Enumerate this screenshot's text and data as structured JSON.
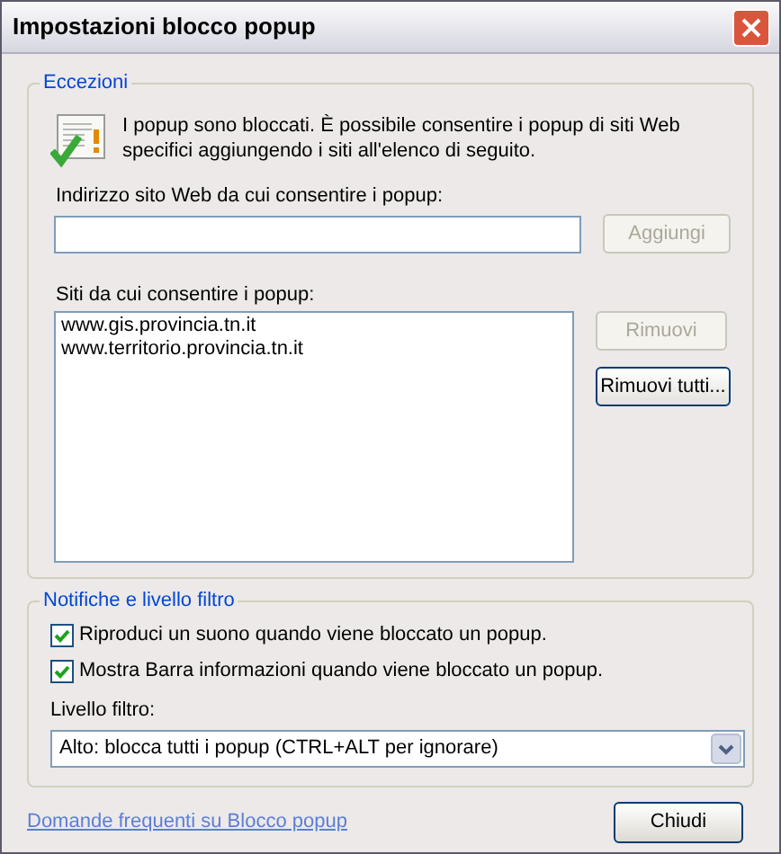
{
  "window": {
    "title": "Impostazioni blocco popup"
  },
  "exceptions": {
    "title": "Eccezioni",
    "description": "I popup sono bloccati. È possibile consentire i popup di siti Web specifici aggiungendo i siti all'elenco di seguito.",
    "address_label": "Indirizzo sito Web da cui consentire i popup:",
    "add_button": {
      "label": "Aggiungi",
      "disabled": true
    },
    "sites_label": "Siti da cui consentire i popup:",
    "sites": [
      "www.gis.provincia.tn.it",
      "www.territorio.provincia.tn.it"
    ],
    "remove_button": {
      "label": "Rimuovi",
      "disabled": true
    },
    "remove_all_button": {
      "label": "Rimuovi tutti...",
      "disabled": false
    }
  },
  "notifications": {
    "title": "Notifiche e livello filtro",
    "options": [
      {
        "label": "Riproduci un suono quando viene bloccato un popup.",
        "checked": true
      },
      {
        "label": "Mostra Barra informazioni quando viene bloccato un popup.",
        "checked": true
      }
    ],
    "filter_label": "Livello filtro:",
    "filter_value": "Alto: blocca tutti i popup (CTRL+ALT per ignorare)"
  },
  "faq_link": "Domande frequenti su Blocco popup",
  "close_button": "Chiudi"
}
